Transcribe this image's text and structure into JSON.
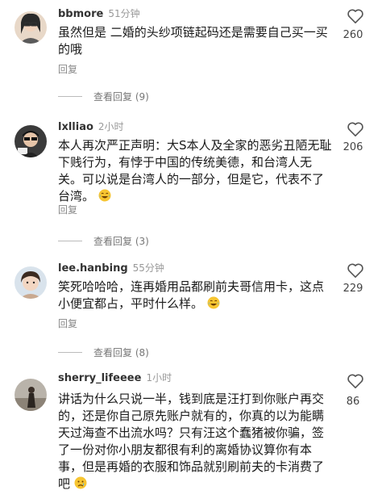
{
  "comments": [
    {
      "username": "bbmore",
      "time": "51分钟",
      "text": "虽然但是 二婚的头纱项链起码还是需要自己买一买的哦",
      "emoji": "",
      "reply": "回复",
      "likes": "260",
      "view_replies": "查看回复 (9)"
    },
    {
      "username": "lxlliao",
      "time": "2小时",
      "text": "本人再次严正声明：大S本人及全家的恶劣丑陋无耻下贱行为，有悖于中国的传统美德，和台湾人无关。可以说是台湾人的一部分，但是它，代表不了台湾。",
      "emoji": "laugh-cry",
      "reply": "回复",
      "likes": "206",
      "view_replies": "查看回复 (3)"
    },
    {
      "username": "lee.hanbing",
      "time": "55分钟",
      "text": "笑死哈哈哈，连再婚用品都刷前夫哥信用卡，这点小便宜都占，平时什么样。",
      "emoji": "laugh-cry",
      "reply": "回复",
      "likes": "229",
      "view_replies": "查看回复 (8)"
    },
    {
      "username": "sherry_lifeeee",
      "time": "1小时",
      "text": "讲话为什么只说一半，钱到底是汪打到你账户再交的，还是你自己原先账户就有的，你真的以为能瞒天过海查不出流水吗？只有汪这个蠢猪被你骗，签了一份对你小朋友都很有利的离婚协议算你有本事，但是再婚的衣服和饰品就别刷前夫的卡消费了吧",
      "emoji": "sad",
      "reply": "回复",
      "likes": "86",
      "view_replies": ""
    }
  ],
  "colors": {
    "username": "#333333",
    "meta": "#999999",
    "text": "#1a1a1a"
  }
}
